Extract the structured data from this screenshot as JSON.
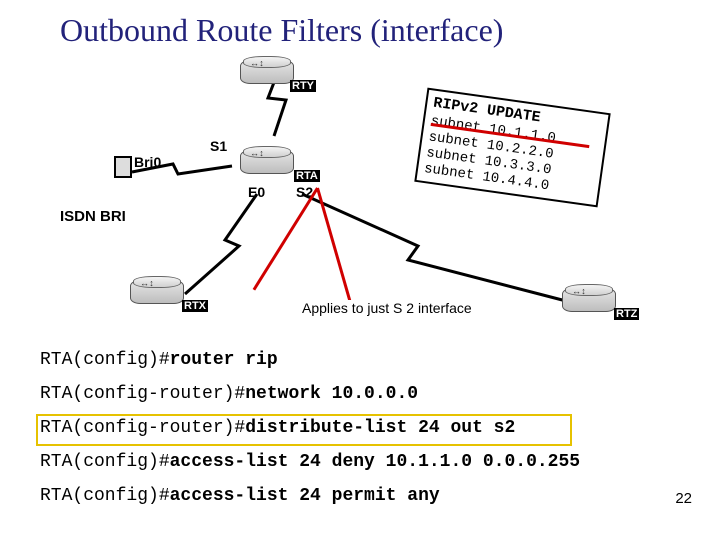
{
  "title": "Outbound Route Filters (interface)",
  "labels": {
    "rty": "RTY",
    "rta": "RTA",
    "rtx": "RTX",
    "rtz": "RTZ",
    "s1": "S1",
    "s2": "S2",
    "bri0": "Bri0",
    "e0": "E0",
    "isdn": "ISDN BRI"
  },
  "update": {
    "header": "RIPv2 UPDATE",
    "rows": [
      "subnet 10.1.1.0",
      "subnet 10.2.2.0",
      "subnet 10.3.3.0",
      "subnet 10.4.4.0"
    ]
  },
  "note": "Applies to just S 2 interface",
  "config": {
    "prompt1": "RTA(config)#",
    "cmd1": "router rip",
    "prompt2": "RTA(config-router)#",
    "cmd2": "network 10.0.0.0",
    "cmd3": "distribute-list 24 out s2",
    "cmd4": "access-list 24 deny 10.1.1.0 0.0.0.255",
    "cmd5": "access-list 24 permit any"
  },
  "pagenum": "22"
}
